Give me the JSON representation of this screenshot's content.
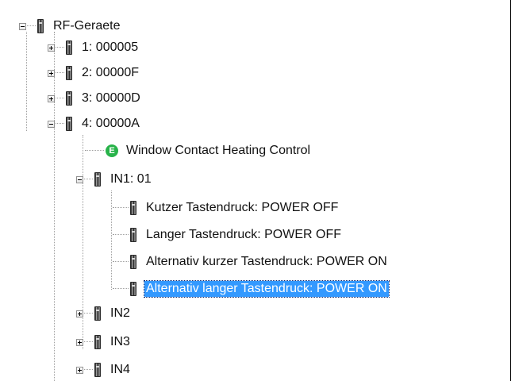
{
  "tree": {
    "root": {
      "label": "RF-Geraete",
      "expanded": true
    },
    "devices": [
      {
        "label": "1: 000005",
        "expanded": false
      },
      {
        "label": "2: 00000F",
        "expanded": false
      },
      {
        "label": "3: 00000D",
        "expanded": false
      },
      {
        "label": "4: 00000A",
        "expanded": true
      }
    ],
    "device4_children": {
      "function": {
        "label": "Window Contact Heating Control",
        "icon": "E"
      },
      "in1": {
        "label": "IN1: 01",
        "expanded": true,
        "items": [
          {
            "label": "Kutzer Tastendruck: POWER OFF"
          },
          {
            "label": "Langer Tastendruck: POWER OFF"
          },
          {
            "label": "Alternativ kurzer Tastendruck: POWER ON"
          },
          {
            "label": "Alternativ langer Tastendruck: POWER ON",
            "selected": true
          }
        ]
      },
      "inputs": [
        {
          "label": "IN2",
          "expanded": false
        },
        {
          "label": "IN3",
          "expanded": false
        },
        {
          "label": "IN4",
          "expanded": false
        }
      ]
    }
  },
  "colors": {
    "selection": "#3399ff",
    "function_icon": "#28b34a"
  }
}
